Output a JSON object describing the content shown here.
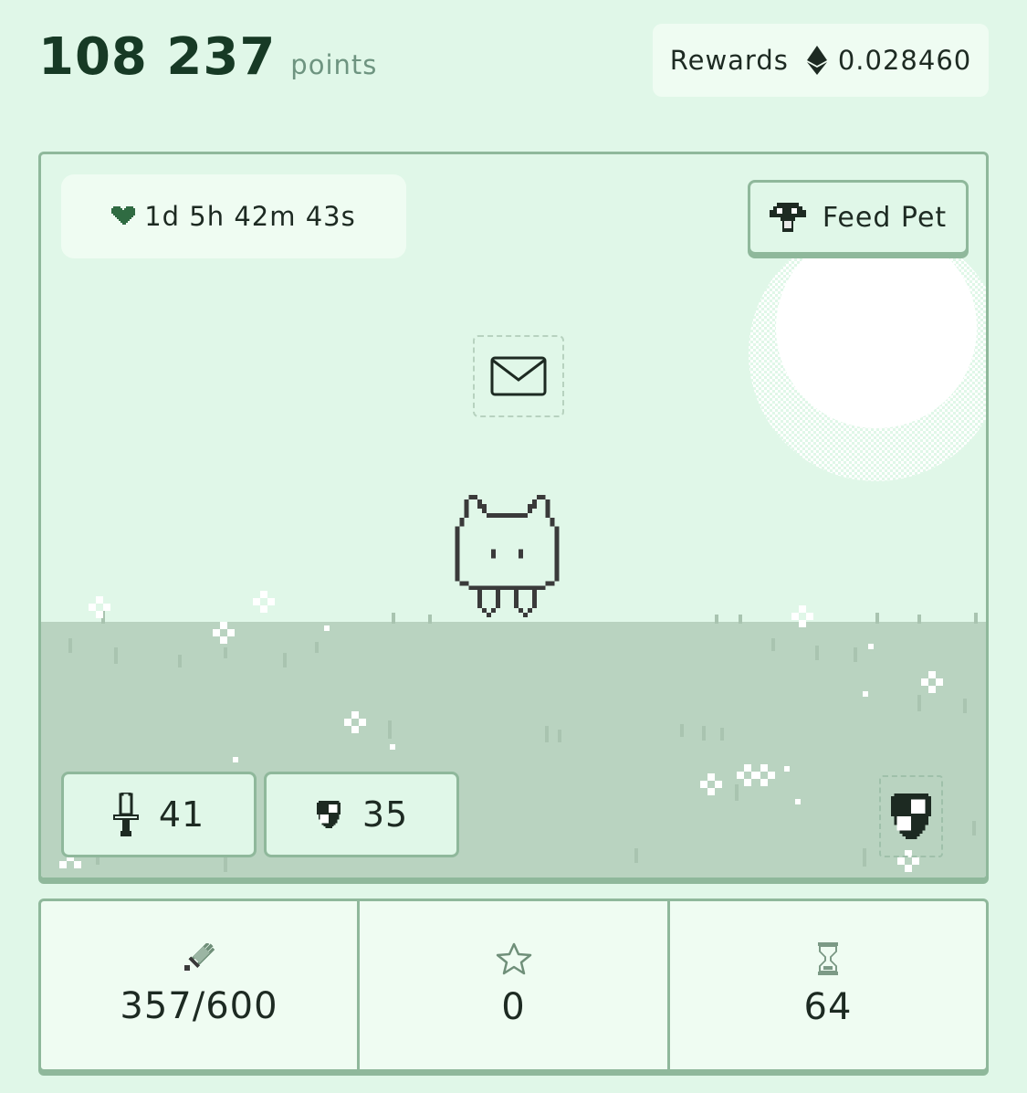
{
  "header": {
    "points_value": "108 237",
    "points_unit": "points",
    "rewards_label": "Rewards",
    "rewards_value": "0.028460",
    "rewards_icon": "ethereum-icon"
  },
  "scene": {
    "timer": {
      "icon": "heart-icon",
      "value": "1d 5h 42m 43s"
    },
    "feed_button": {
      "icon": "mushroom-icon",
      "label": "Feed Pet"
    },
    "mail_icon": "envelope-icon",
    "pet": "pixel-cat",
    "attack": {
      "icon": "sword-icon",
      "value": "41"
    },
    "defense": {
      "icon": "shield-icon",
      "value": "35"
    },
    "shield_toggle_icon": "shield-icon"
  },
  "stats": [
    {
      "icon": "sword-icon",
      "value": "357/600"
    },
    {
      "icon": "star-icon",
      "value": "0"
    },
    {
      "icon": "hourglass-icon",
      "value": "64"
    }
  ],
  "colors": {
    "background": "#e0f7e8",
    "panel": "#effcf2",
    "border": "#8fb89b",
    "ground": "#b9d3c0",
    "text": "#1d2a22",
    "accent_dark": "#173a25"
  }
}
